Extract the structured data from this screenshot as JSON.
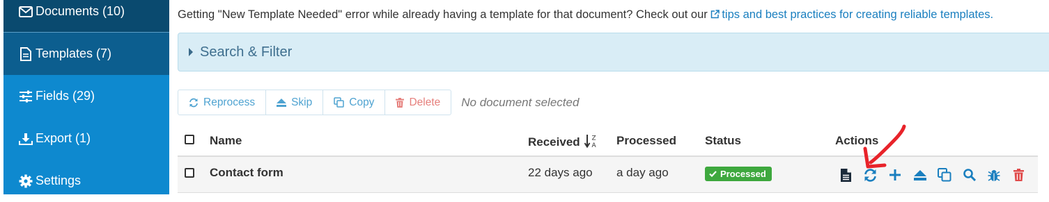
{
  "sidebar": {
    "items": [
      {
        "label": "Documents (10)",
        "icon": "envelope-icon"
      },
      {
        "label": "Templates (7)",
        "icon": "file-icon"
      },
      {
        "label": "Fields (29)",
        "icon": "sliders-icon"
      },
      {
        "label": "Export (1)",
        "icon": "download-icon"
      },
      {
        "label": "Settings",
        "icon": "gear-icon"
      }
    ]
  },
  "notice": {
    "text": "Getting \"New Template Needed\" error while already having a template for that document? Check out our ",
    "link": "tips and best practices for creating reliable templates."
  },
  "filter": {
    "label": "Search & Filter"
  },
  "toolbar": {
    "reprocess": "Reprocess",
    "skip": "Skip",
    "copy": "Copy",
    "delete": "Delete",
    "status": "No document selected"
  },
  "table": {
    "headers": {
      "name": "Name",
      "received": "Received",
      "processed": "Processed",
      "status": "Status",
      "actions": "Actions"
    },
    "rows": [
      {
        "name": "Contact form",
        "received": "22 days ago",
        "processed": "a day ago",
        "status": "Processed"
      }
    ]
  },
  "colors": {
    "sidebar": "#0e89cf",
    "sidebar_active": "#0c5e8f",
    "accent": "#1a7fbf",
    "success": "#3ea83e",
    "danger": "#e04b4b",
    "annotation": "#e8232a"
  }
}
